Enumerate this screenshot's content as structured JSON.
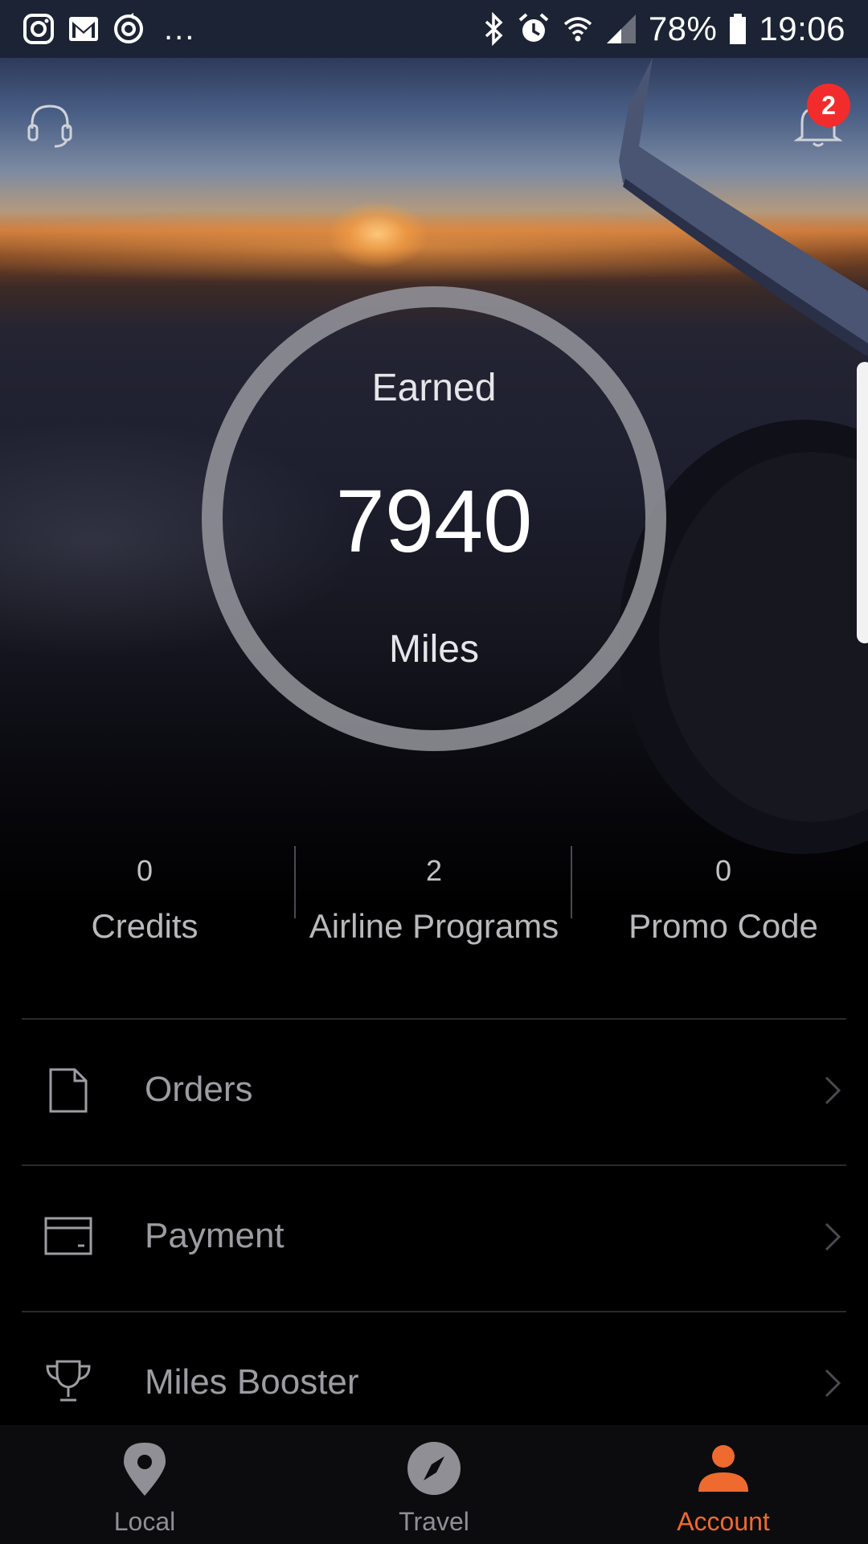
{
  "status_bar": {
    "left_icons": [
      "instagram-icon",
      "gmail-icon",
      "clock-sync-icon"
    ],
    "overflow": "...",
    "right_icons": [
      "bluetooth-icon",
      "alarm-icon",
      "wifi-icon",
      "cell-signal-icon"
    ],
    "battery": "78%",
    "time": "19:06"
  },
  "header": {
    "support_icon": "headset-icon",
    "notifications_icon": "bell-icon",
    "notification_count": "2"
  },
  "earned": {
    "label": "Earned",
    "value": "7940",
    "unit": "Miles"
  },
  "stats": [
    {
      "value": "0",
      "label": "Credits"
    },
    {
      "value": "2",
      "label": "Airline Programs"
    },
    {
      "value": "0",
      "label": "Promo Code"
    }
  ],
  "menu": [
    {
      "label": "Orders",
      "icon": "document-icon"
    },
    {
      "label": "Payment",
      "icon": "card-icon"
    },
    {
      "label": "Miles Booster",
      "icon": "trophy-icon"
    }
  ],
  "bottom_nav": {
    "tabs": [
      {
        "label": "Local",
        "icon": "location-pin-icon"
      },
      {
        "label": "Travel",
        "icon": "compass-icon"
      },
      {
        "label": "Account",
        "icon": "person-icon"
      }
    ],
    "active": "Account"
  },
  "colors": {
    "accent": "#ef6a2e",
    "badge": "#f22c2c",
    "status_bar_bg": "#1b2334",
    "text_muted": "#9c9ca2"
  }
}
